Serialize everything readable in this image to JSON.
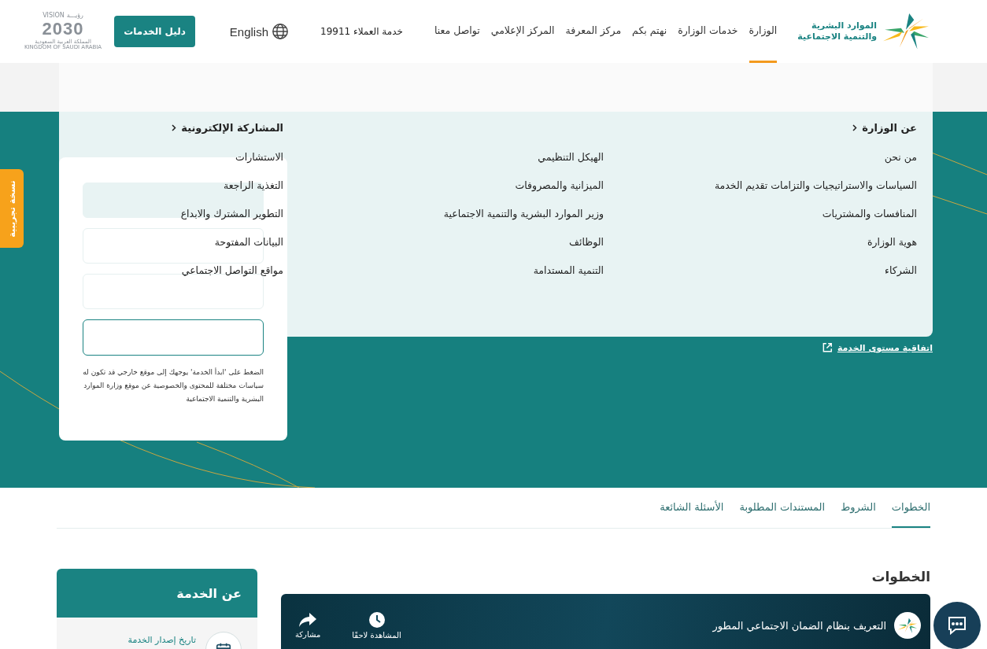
{
  "header": {
    "logo_text": [
      "الموارد البشرية",
      "والتنمية الاجتماعية"
    ],
    "nav": [
      {
        "label": "الوزارة",
        "selected": true
      },
      {
        "label": "خدمات الوزارة",
        "selected": false
      },
      {
        "label": "نهتم بكم",
        "selected": false
      },
      {
        "label": "مركز المعرفة",
        "selected": false
      },
      {
        "label": "المركز الإعلامي",
        "selected": false
      },
      {
        "label": "تواصل معنا",
        "selected": false
      }
    ],
    "customer_service": "خدمة العملاء 19911",
    "language": "English",
    "services_button": "دليل الخدمات",
    "vision": {
      "en": "VISION",
      "ar": "رؤيـــة",
      "year": "2030",
      "country_ar": "المملكة العربية السعودية",
      "country_en": "KINGDOM OF SAUDI ARABIA"
    }
  },
  "mega_menu": {
    "columns": [
      {
        "title": "عن الوزارة",
        "items": [
          "من نحن",
          "السياسات والاستراتيجيات والتزامات تقديم الخدمة",
          "المنافسات والمشتريات",
          "هوية الوزارة",
          "الشركاء"
        ]
      },
      {
        "items": [
          "الهيكل التنظيمي",
          "الميزانية والمصروفات",
          "وزير الموارد البشرية والتنمية الاجتماعية",
          "الوظائف",
          "التنمية المستدامة"
        ]
      },
      {
        "title": "المشاركة الإلكترونية",
        "items": [
          "الاستشارات",
          "التغذية الراجعة",
          "التطوير المشترك والابداع",
          "البيانات المفتوحة",
          "مواقع التواصل الاجتماعي"
        ]
      }
    ]
  },
  "side_tab": "نسخة تجريبية",
  "service_card": {
    "note": "الضغط على 'ابدأ الخدمة' يوجهك إلى موقع خارجي قد تكون له سياسات مختلفة للمحتوى والخصوصية عن موقع وزارة الموارد البشرية والتنمية الاجتماعية"
  },
  "sla_link": "اتفاقية مستوى الخدمة",
  "tabs": [
    {
      "label": "الخطوات",
      "selected": true
    },
    {
      "label": "الشروط",
      "selected": false
    },
    {
      "label": "المستندات المطلوبة",
      "selected": false
    },
    {
      "label": "الأسئلة الشائعة",
      "selected": false
    }
  ],
  "steps": {
    "heading": "الخطوات",
    "video": {
      "title": "التعريف بنظام الضمان الاجتماعي المطور",
      "watch_later": "المشاهدة لاحقًا",
      "share": "مشاركة"
    }
  },
  "about": {
    "title": "عن الخدمة",
    "rows": [
      {
        "label": "تاريخ إصدار الخدمة"
      }
    ]
  }
}
